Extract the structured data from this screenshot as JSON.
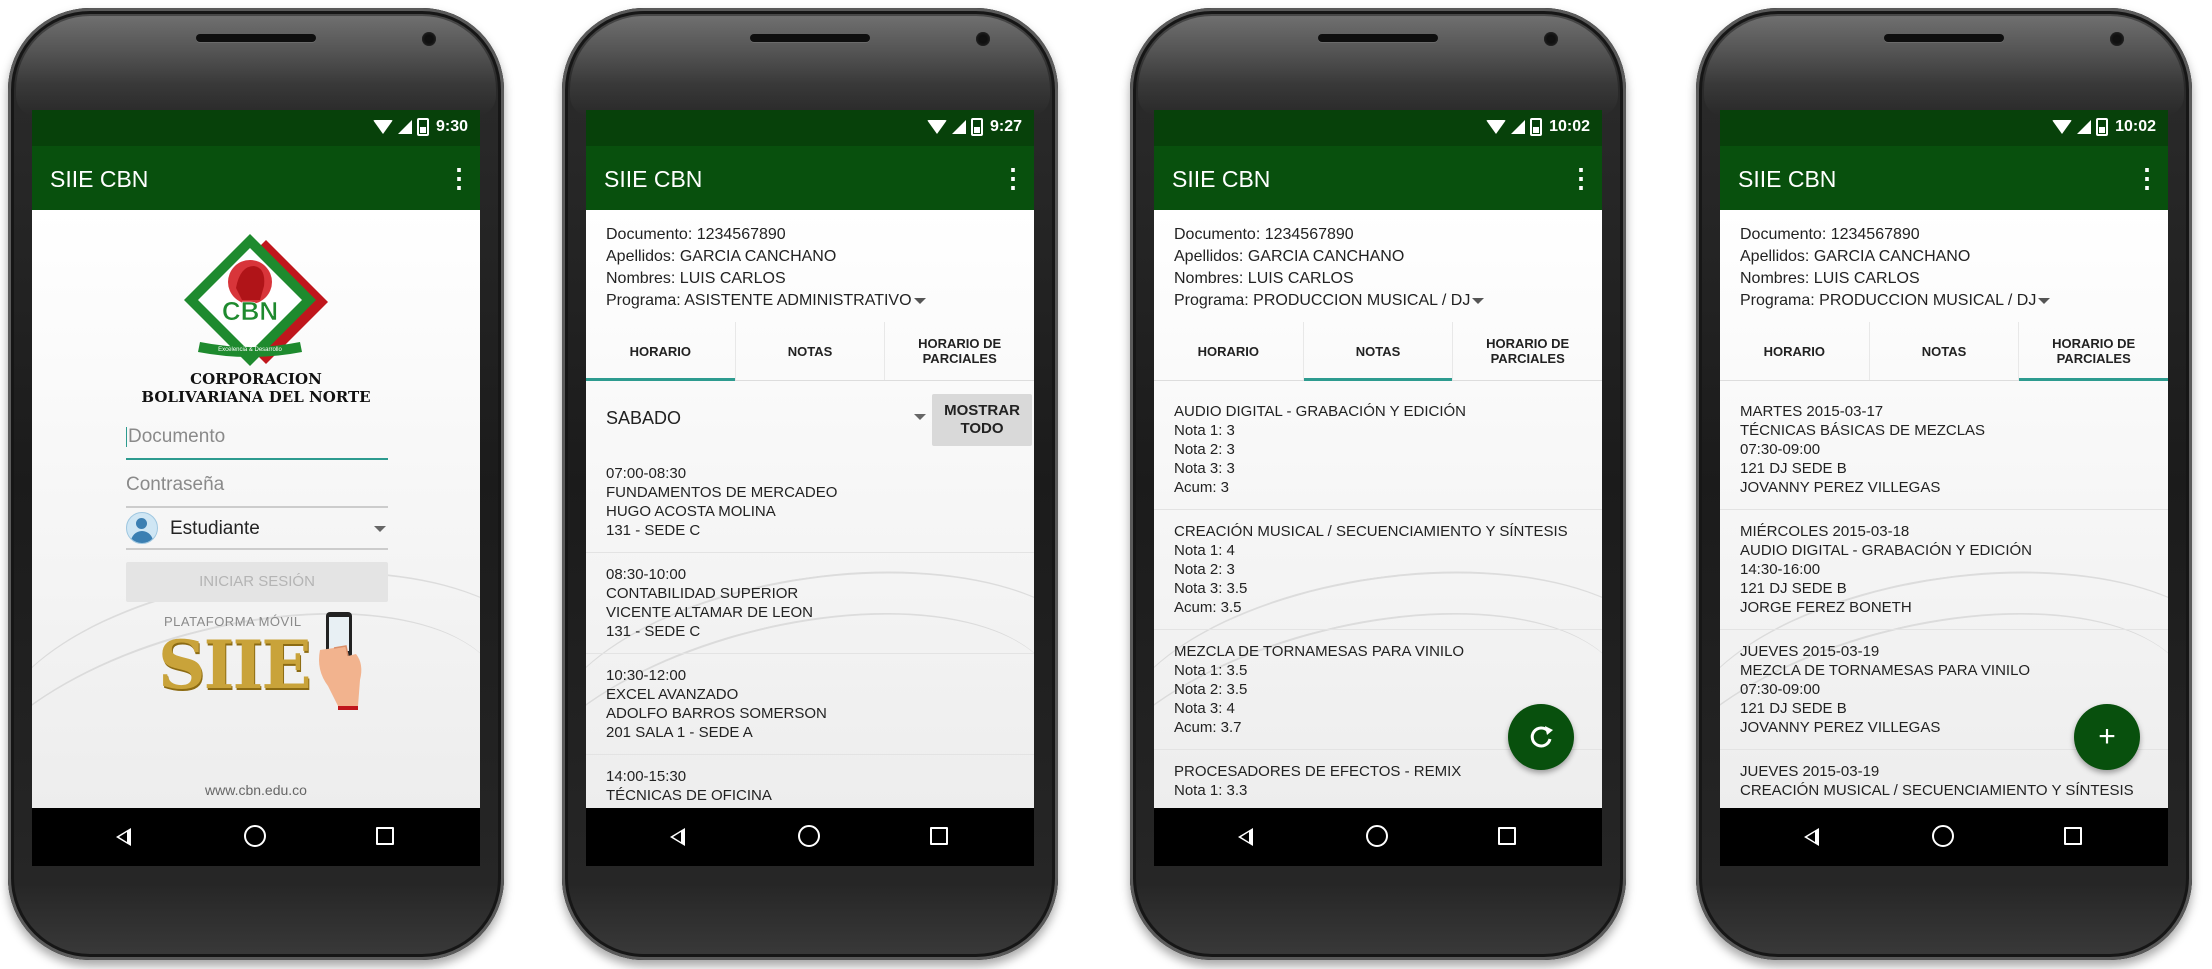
{
  "status_times": [
    "9:30",
    "9:27",
    "10:02",
    "10:02"
  ],
  "app_title": "SIIE CBN",
  "login": {
    "org_line1": "CORPORACION",
    "org_line2": "BOLIVARIANA DEL NORTE",
    "logo_text": "CBN",
    "logo_ribbon": "Excelencia & Desarrollo",
    "document_placeholder": "Documento",
    "password_placeholder": "Contraseña",
    "role": "Estudiante",
    "login_button": "INICIAR SESIÓN",
    "platform_caption": "PLATAFORMA MÓVIL",
    "siie_logo": "SIIE",
    "website": "www.cbn.edu.co"
  },
  "student": {
    "document": "Documento: 1234567890",
    "surnames": "Apellidos: GARCIA CANCHANO",
    "names": "Nombres: LUIS CARLOS"
  },
  "programs": [
    "Programa: ASISTENTE ADMINISTRATIVO",
    "Programa: PRODUCCION MUSICAL / DJ",
    "Programa: PRODUCCION MUSICAL / DJ"
  ],
  "tabs": {
    "horario": "HORARIO",
    "notas": "NOTAS",
    "parciales_line1": "HORARIO DE",
    "parciales_line2": "PARCIALES"
  },
  "schedule": {
    "day": "SABADO",
    "show_all_line1": "MOSTRAR",
    "show_all_line2": "TODO",
    "items": [
      {
        "l1": "07:00-08:30",
        "l2": "FUNDAMENTOS DE MERCADEO",
        "l3": "HUGO ACOSTA MOLINA",
        "l4": "131 - SEDE C"
      },
      {
        "l1": "08:30-10:00",
        "l2": "CONTABILIDAD SUPERIOR",
        "l3": "VICENTE ALTAMAR  DE LEON",
        "l4": "131 - SEDE C"
      },
      {
        "l1": "10:30-12:00",
        "l2": "EXCEL AVANZADO",
        "l3": "ADOLFO BARROS SOMERSON",
        "l4": "201 SALA 1 - SEDE A"
      },
      {
        "l1": "14:00-15:30",
        "l2": "TÉCNICAS DE OFICINA",
        "l3": "",
        "l4": ""
      }
    ]
  },
  "grades": {
    "items": [
      {
        "l1": "AUDIO DIGITAL - GRABACIÓN Y EDICIÓN",
        "l2": "Nota 1: 3",
        "l3": "Nota 2: 3",
        "l4": "Nota 3: 3",
        "l5": "Acum: 3"
      },
      {
        "l1": "CREACIÓN MUSICAL / SECUENCIAMIENTO Y SÍNTESIS",
        "l2": "Nota 1: 4",
        "l3": "Nota 2: 3",
        "l4": "Nota 3: 3.5",
        "l5": "Acum: 3.5"
      },
      {
        "l1": "MEZCLA DE TORNAMESAS PARA VINILO",
        "l2": "Nota 1: 3.5",
        "l3": "Nota 2: 3.5",
        "l4": "Nota 3: 4",
        "l5": "Acum: 3.7"
      },
      {
        "l1": "PROCESADORES DE EFECTOS  - REMIX",
        "l2": "Nota 1: 3.3",
        "l3": "",
        "l4": "",
        "l5": ""
      }
    ],
    "fab_icon": "refresh-icon"
  },
  "partials": {
    "items": [
      {
        "l1": "MARTES 2015-03-17",
        "l2": "TÉCNICAS BÁSICAS DE MEZCLAS",
        "l3": "07:30-09:00",
        "l4": "121 DJ SEDE B",
        "l5": "JOVANNY PEREZ VILLEGAS"
      },
      {
        "l1": "MIÉRCOLES 2015-03-18",
        "l2": "AUDIO DIGITAL - GRABACIÓN Y EDICIÓN",
        "l3": "14:30-16:00",
        "l4": "121 DJ SEDE B",
        "l5": "JORGE FEREZ BONETH"
      },
      {
        "l1": "JUEVES 2015-03-19",
        "l2": "MEZCLA DE TORNAMESAS PARA VINILO",
        "l3": "07:30-09:00",
        "l4": "121 DJ SEDE B",
        "l5": "JOVANNY PEREZ VILLEGAS"
      },
      {
        "l1": "JUEVES 2015-03-19",
        "l2": "CREACIÓN MUSICAL / SECUENCIAMIENTO Y SÍNTESIS",
        "l3": "",
        "l4": "",
        "l5": ""
      }
    ],
    "fab_label": "+"
  },
  "colors": {
    "status_bar": "#07410a",
    "app_bar": "#08500d",
    "accent": "#2d9b8f"
  }
}
